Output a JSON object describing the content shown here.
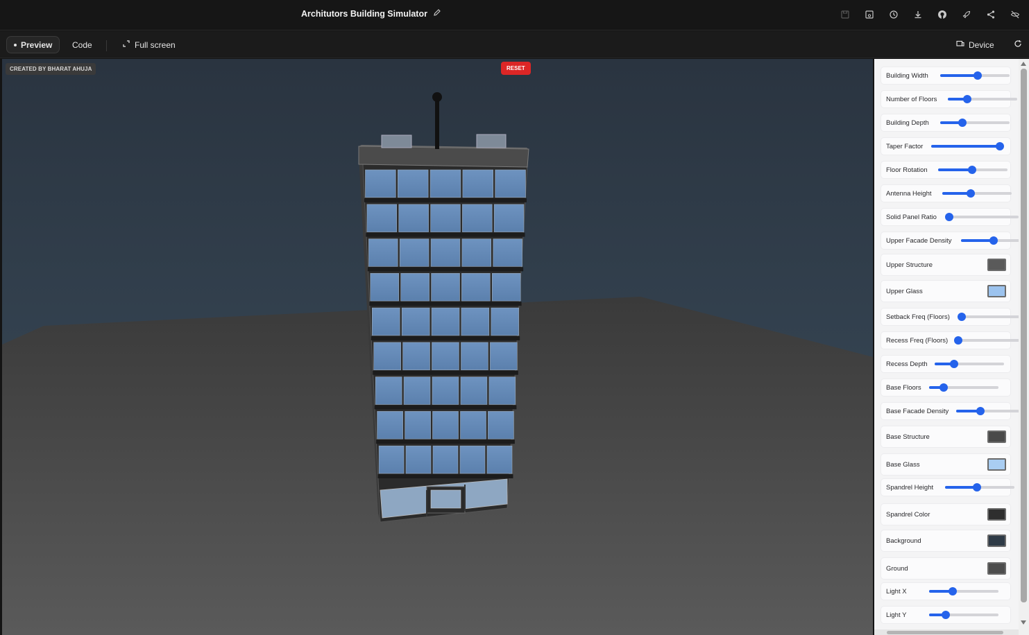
{
  "header": {
    "title": "Architutors Building Simulator"
  },
  "toolbar": {
    "preview_label": "Preview",
    "code_label": "Code",
    "fullscreen_label": "Full screen",
    "device_label": "Device"
  },
  "top_icons": [
    "save-disabled-icon",
    "save-icon",
    "history-icon",
    "download-icon",
    "github-icon",
    "rocket-icon",
    "share-icon",
    "hide-icon"
  ],
  "viewport": {
    "credit": "CREATED BY BHARAT AHUJA",
    "reset_label": "RESET"
  },
  "controls": [
    {
      "label": "Building Width",
      "type": "slider",
      "value": 0.54
    },
    {
      "label": "Number of Floors",
      "type": "slider",
      "value": 0.28
    },
    {
      "label": "Building Depth",
      "type": "slider",
      "value": 0.32
    },
    {
      "label": "Taper Factor",
      "type": "slider",
      "value": 0.99
    },
    {
      "label": "Floor Rotation",
      "type": "slider",
      "value": 0.49
    },
    {
      "label": "Antenna Height",
      "type": "slider",
      "value": 0.41
    },
    {
      "label": "Solid Panel Ratio",
      "type": "slider",
      "value": 0.0
    },
    {
      "label": "Upper Facade Density",
      "type": "slider",
      "value": 0.47
    },
    {
      "label": "Upper Structure",
      "type": "color",
      "color": "#5a5a5a"
    },
    {
      "label": "Upper Glass",
      "type": "color",
      "color": "#9cc3ee"
    },
    {
      "label": "Setback Freq (Floors)",
      "type": "slider",
      "value": 0.0
    },
    {
      "label": "Recess Freq (Floors)",
      "type": "slider",
      "value": 0.0
    },
    {
      "label": "Recess Depth",
      "type": "slider",
      "value": 0.28
    },
    {
      "label": "Base Floors",
      "type": "slider",
      "value": 0.21
    },
    {
      "label": "Base Facade Density",
      "type": "slider",
      "value": 0.35
    },
    {
      "label": "Base Structure",
      "type": "color",
      "color": "#4a4a4a"
    },
    {
      "label": "Base Glass",
      "type": "color",
      "color": "#a9cdf2"
    },
    {
      "label": "Spandrel Height",
      "type": "slider",
      "value": 0.46
    },
    {
      "label": "Spandrel Color",
      "type": "color",
      "color": "#2e2e2e"
    },
    {
      "label": "Background",
      "type": "color",
      "color": "#2f3b47"
    },
    {
      "label": "Ground",
      "type": "color",
      "color": "#4d4d4d"
    },
    {
      "label": "Light X",
      "type": "slider",
      "value": 0.34
    },
    {
      "label": "Light Y",
      "type": "slider",
      "value": 0.24
    }
  ],
  "colors": {
    "accent": "#2563eb",
    "reset": "#dc2626",
    "sky": "#354452",
    "ground": "#505050"
  }
}
